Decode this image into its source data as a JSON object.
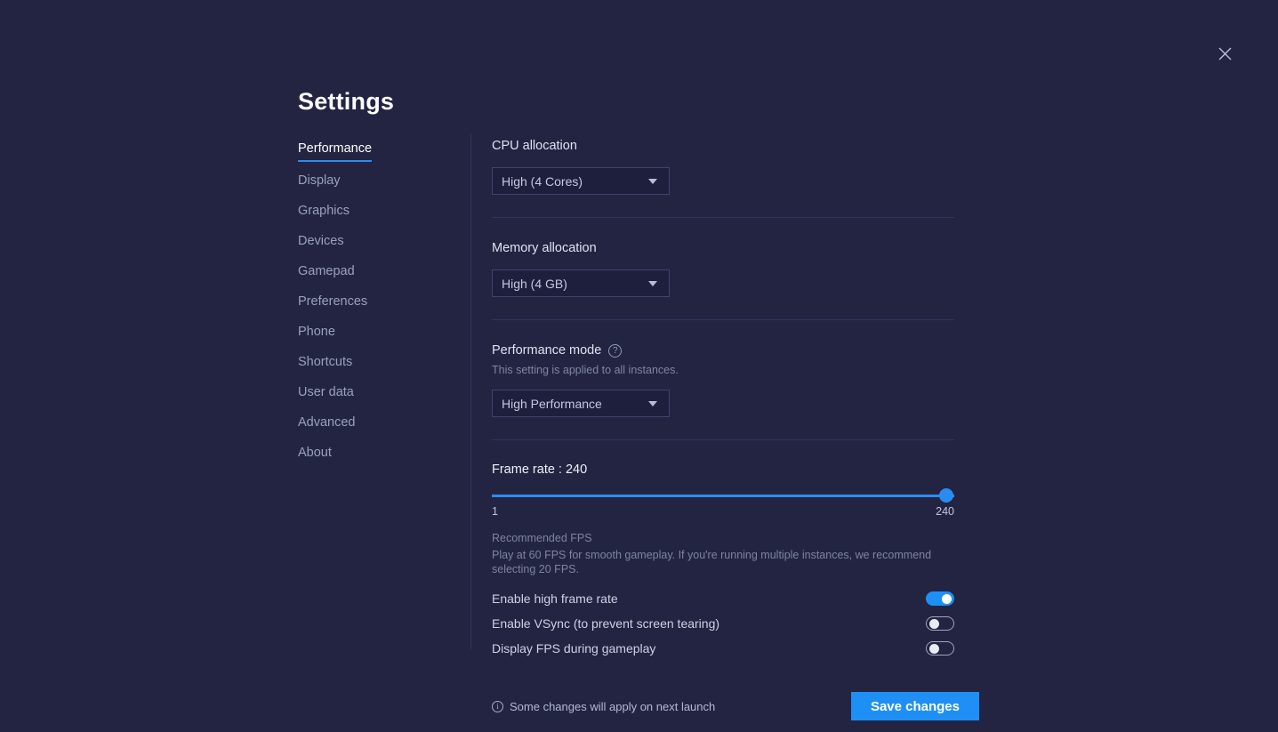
{
  "window": {
    "title": "Settings",
    "close_icon": "close-icon"
  },
  "sidebar": {
    "items": [
      {
        "label": "Performance",
        "active": true
      },
      {
        "label": "Display",
        "active": false
      },
      {
        "label": "Graphics",
        "active": false
      },
      {
        "label": "Devices",
        "active": false
      },
      {
        "label": "Gamepad",
        "active": false
      },
      {
        "label": "Preferences",
        "active": false
      },
      {
        "label": "Phone",
        "active": false
      },
      {
        "label": "Shortcuts",
        "active": false
      },
      {
        "label": "User data",
        "active": false
      },
      {
        "label": "Advanced",
        "active": false
      },
      {
        "label": "About",
        "active": false
      }
    ]
  },
  "main": {
    "cpu": {
      "label": "CPU allocation",
      "value": "High (4 Cores)"
    },
    "memory": {
      "label": "Memory allocation",
      "value": "High (4 GB)"
    },
    "performance_mode": {
      "label": "Performance mode",
      "help_icon": "question-mark-icon",
      "note": "This setting is applied to all instances.",
      "value": "High Performance"
    },
    "frame_rate": {
      "title": "Frame rate : 240",
      "value": 240,
      "min_label": "1",
      "max_label": "240",
      "min": 1,
      "max": 240,
      "recommend_heading": "Recommended FPS",
      "recommend_body": "Play at 60 FPS for smooth gameplay. If you're running multiple instances, we recommend selecting 20 FPS."
    },
    "toggles": [
      {
        "label": "Enable high frame rate",
        "on": true
      },
      {
        "label": "Enable VSync (to prevent screen tearing)",
        "on": false
      },
      {
        "label": "Display FPS during gameplay",
        "on": false
      }
    ]
  },
  "footer": {
    "info_icon": "info-icon",
    "note": "Some changes will apply on next launch",
    "save_label": "Save changes"
  },
  "colors": {
    "background": "#222442",
    "accent": "#2b8cf0",
    "button": "#1e90f5",
    "panel": "#1d1f3d"
  }
}
